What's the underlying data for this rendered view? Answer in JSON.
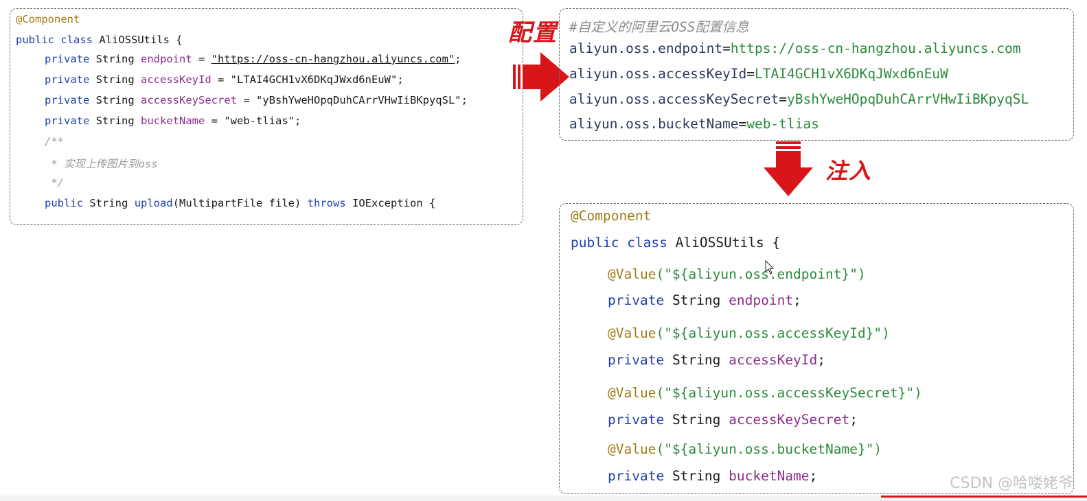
{
  "left_code": {
    "annotation": "@Component",
    "class_decl": {
      "kw": "public class",
      "name": "AliOSSUtils {"
    },
    "fields": [
      {
        "kw": "private",
        "type": "String",
        "name": "endpoint",
        "eq": " = ",
        "value": "\"https://oss-cn-hangzhou.aliyuncs.com\"",
        "end": ";"
      },
      {
        "kw": "private",
        "type": "String",
        "name": "accessKeyId",
        "eq": " = ",
        "value": "\"LTAI4GCH1vX6DKqJWxd6nEuW\"",
        "end": ";"
      },
      {
        "kw": "private",
        "type": "String",
        "name": "accessKeySecret",
        "eq": " = ",
        "value": "\"yBshYweHOpqDuhCArrVHwIiBKpyqSL\"",
        "end": ";"
      },
      {
        "kw": "private",
        "type": "String",
        "name": "bucketName",
        "eq": " = ",
        "value": "\"web-tlias\"",
        "end": ";"
      }
    ],
    "comment": [
      "/**",
      " * 实现上传图片到oss",
      " */"
    ],
    "method": {
      "kw": "public",
      "type": "String",
      "name": "upload",
      "params": "(MultipartFile file)",
      "throws": "throws",
      "exc": "IOException {"
    }
  },
  "labels": {
    "config": "配置",
    "inject": "注入"
  },
  "props": {
    "comment": "#自定义的阿里云OSS配置信息",
    "lines": [
      {
        "key": "aliyun.oss.endpoint",
        "eq": "=",
        "value": "https://oss-cn-hangzhou.aliyuncs.com"
      },
      {
        "key": "aliyun.oss.accessKeyId",
        "eq": "=",
        "value": "LTAI4GCH1vX6DKqJWxd6nEuW"
      },
      {
        "key": "aliyun.oss.accessKeySecret",
        "eq": "=",
        "value": "yBshYweHOpqDuhCArrVHwIiBKpyqSL"
      },
      {
        "key": "aliyun.oss.bucketName",
        "eq": "=",
        "value": "web-tlias"
      }
    ]
  },
  "inject_code": {
    "annotation": "@Component",
    "class_decl": {
      "kw": "public class",
      "name": "AliOSSUtils {"
    },
    "fields": [
      {
        "ann": "@Value",
        "arg": "(\"${aliyun.oss.endpoint}\")",
        "kw": "private",
        "type": "String",
        "name": "endpoint",
        "end": ";"
      },
      {
        "ann": "@Value",
        "arg": "(\"${aliyun.oss.accessKeyId}\")",
        "kw": "private",
        "type": "String",
        "name": "accessKeyId",
        "end": ";"
      },
      {
        "ann": "@Value",
        "arg": "(\"${aliyun.oss.accessKeySecret}\")",
        "kw": "private",
        "type": "String",
        "name": "accessKeySecret",
        "end": ";"
      },
      {
        "ann": "@Value",
        "arg": "(\"${aliyun.oss.bucketName}\")",
        "kw": "private",
        "type": "String",
        "name": "bucketName",
        "end": ";"
      }
    ]
  },
  "watermark": "CSDN @哈喽姥爷",
  "colors": {
    "arrow": "#d8161a",
    "keyword": "#1f3fa8",
    "field": "#8b2d8b",
    "annotation": "#a37a16",
    "value_green": "#2a8a3a"
  }
}
